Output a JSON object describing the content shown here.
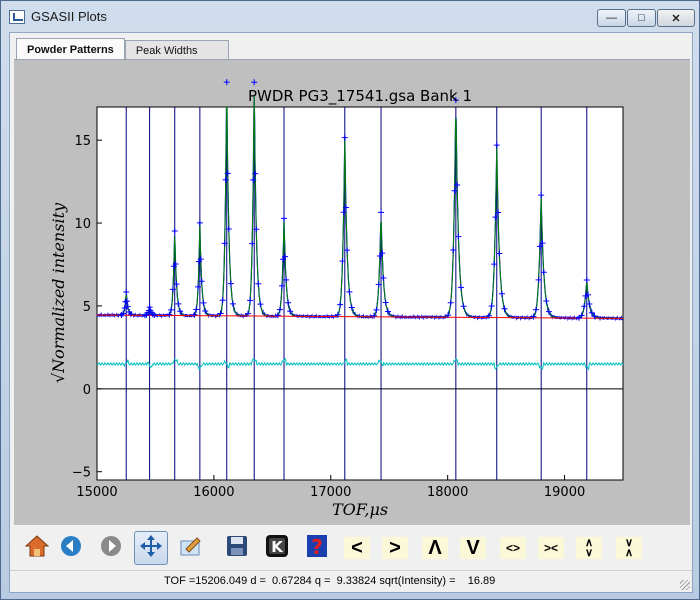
{
  "window": {
    "title": "GSASII Plots",
    "buttons": [
      "minimize",
      "maximize",
      "close"
    ]
  },
  "tabs": [
    {
      "label": "Powder Patterns",
      "active": true
    },
    {
      "label": "Peak Widths",
      "active": false
    }
  ],
  "toolbar": {
    "buttons": [
      {
        "name": "home",
        "icon": "home-icon"
      },
      {
        "name": "back",
        "icon": "arrow-left-icon"
      },
      {
        "name": "forward",
        "icon": "arrow-right-icon"
      },
      {
        "name": "pan",
        "icon": "move-icon",
        "pressed": true
      },
      {
        "name": "configure-subplots",
        "icon": "subplots-icon"
      },
      {
        "name": "save",
        "icon": "floppy-icon"
      },
      {
        "name": "key-press",
        "icon": "k-key-icon",
        "label": "K"
      },
      {
        "name": "help",
        "icon": "help-icon",
        "label": "?"
      },
      {
        "name": "shift-left",
        "label": "<"
      },
      {
        "name": "shift-right",
        "label": ">"
      },
      {
        "name": "shift-up",
        "label": "Λ"
      },
      {
        "name": "shift-down",
        "label": "V"
      },
      {
        "name": "expand-x",
        "label": "<>"
      },
      {
        "name": "contract-x",
        "label": "><"
      },
      {
        "name": "expand-y",
        "label": "∧\n∨"
      },
      {
        "name": "contract-y",
        "label": "∨\n∧"
      }
    ]
  },
  "status": {
    "text": "TOF =15206.049 d =  0.67284 q =  9.33824 sqrt(Intensity) =    16.89"
  },
  "colors": {
    "observed": "#0000ff",
    "calculated": "#008000",
    "background": "#ff0000",
    "difference": "#00bfbf",
    "reflection_ticks": "#000080",
    "zero_line": "#000000"
  },
  "chart_data": {
    "type": "line",
    "title": "PWDR PG3_17541.gsa Bank 1",
    "xlabel": "TOF,μs",
    "ylabel": "√Normalized intensity",
    "xlim": [
      15000,
      19500
    ],
    "ylim": [
      -5.5,
      17
    ],
    "xticks": [
      15000,
      16000,
      17000,
      18000,
      19000
    ],
    "yticks": [
      -5,
      0,
      5,
      10,
      15
    ],
    "background_line": {
      "x": [
        15000,
        19500
      ],
      "y": [
        4.45,
        4.25
      ]
    },
    "difference_level": 1.5,
    "zero_line": 0,
    "peaks": [
      {
        "x": 15250,
        "height": 5.8,
        "width": 12
      },
      {
        "x": 15450,
        "height": 4.9,
        "width": 12
      },
      {
        "x": 15665,
        "height": 9.5,
        "width": 14
      },
      {
        "x": 15880,
        "height": 10.0,
        "width": 14
      },
      {
        "x": 16110,
        "height": 18.5,
        "width": 16
      },
      {
        "x": 16345,
        "height": 18.5,
        "width": 16
      },
      {
        "x": 16600,
        "height": 10.3,
        "width": 16
      },
      {
        "x": 17120,
        "height": 15.2,
        "width": 18
      },
      {
        "x": 17430,
        "height": 10.7,
        "width": 18
      },
      {
        "x": 18070,
        "height": 17.5,
        "width": 20
      },
      {
        "x": 18420,
        "height": 14.8,
        "width": 20
      },
      {
        "x": 18800,
        "height": 11.8,
        "width": 20
      },
      {
        "x": 19190,
        "height": 6.7,
        "width": 20
      }
    ],
    "reflection_positions": [
      15250,
      15450,
      15665,
      15880,
      16110,
      16345,
      16600,
      17120,
      17430,
      18070,
      18420,
      18800,
      19190
    ]
  }
}
